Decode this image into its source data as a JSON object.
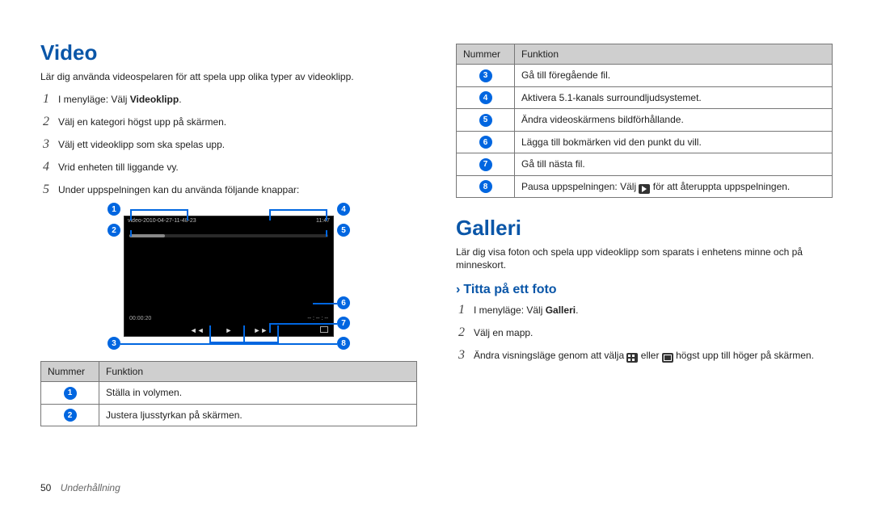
{
  "left": {
    "heading": "Video",
    "intro": "Lär dig använda videospelaren för att spela upp olika typer av videoklipp.",
    "steps": [
      {
        "n": "1",
        "pre": "I menyläge: Välj ",
        "bold": "Videoklipp",
        "post": "."
      },
      {
        "n": "2",
        "plain": "Välj en kategori högst upp på skärmen."
      },
      {
        "n": "3",
        "plain": "Välj ett videoklipp som ska spelas upp."
      },
      {
        "n": "4",
        "plain": "Vrid enheten till liggande vy."
      },
      {
        "n": "5",
        "plain": "Under uppspelningen kan du använda följande knappar:"
      }
    ],
    "player": {
      "title": "video-2010-04-27-11-48-23",
      "battery": "11:47",
      "time_cur": "00:00:20",
      "time_rem": "-- : -- : --"
    },
    "callouts": {
      "1": "1",
      "2": "2",
      "3": "3",
      "4": "4",
      "5": "5",
      "6": "6",
      "7": "7",
      "8": "8"
    },
    "table_head": {
      "num": "Nummer",
      "func": "Funktion"
    },
    "table_rows": [
      {
        "n": "1",
        "text": "Ställa in volymen."
      },
      {
        "n": "2",
        "text": "Justera ljusstyrkan på skärmen."
      }
    ]
  },
  "right": {
    "table_head": {
      "num": "Nummer",
      "func": "Funktion"
    },
    "table_rows": [
      {
        "n": "3",
        "text": "Gå till föregående fil."
      },
      {
        "n": "4",
        "text": "Aktivera 5.1-kanals surroundljudsystemet."
      },
      {
        "n": "5",
        "text": "Ändra videoskärmens bildförhållande."
      },
      {
        "n": "6",
        "text": "Lägga till bokmärken vid den punkt du vill."
      },
      {
        "n": "7",
        "text": "Gå till nästa fil."
      },
      {
        "n": "8",
        "pre": "Pausa uppspelningen: Välj ",
        "post": " för att återuppta uppspelningen."
      }
    ],
    "gallery_heading": "Galleri",
    "gallery_intro": "Lär dig visa foton och spela upp videoklipp som sparats i enhetens minne och på minneskort.",
    "sub_heading": "Titta på ett foto",
    "gallery_steps": [
      {
        "n": "1",
        "pre": "I menyläge: Välj ",
        "bold": "Galleri",
        "post": "."
      },
      {
        "n": "2",
        "plain": "Välj en mapp."
      },
      {
        "n": "3",
        "pre": "Ändra visningsläge genom att välja ",
        "mid": " eller ",
        "post": " högst upp till höger på skärmen."
      }
    ]
  },
  "footer": {
    "page": "50",
    "section": "Underhållning"
  }
}
